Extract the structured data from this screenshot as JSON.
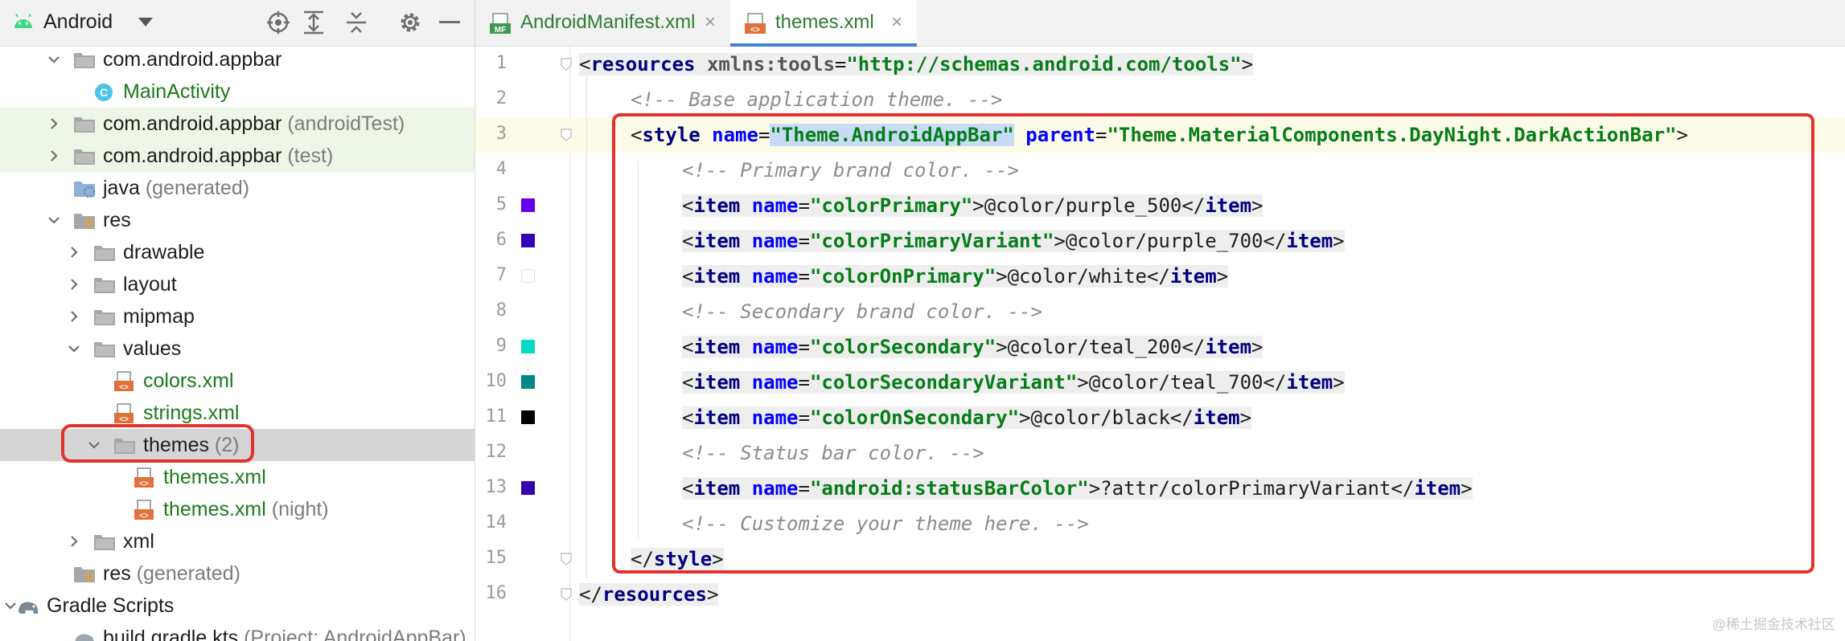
{
  "project_panel": {
    "view_label": "Android",
    "tree": [
      {
        "label": "com.android.appbar",
        "suffix": "",
        "type": "package",
        "arrow": "expanded"
      },
      {
        "label": "MainActivity",
        "suffix": "",
        "type": "class",
        "arrow": "none"
      },
      {
        "label": "com.android.appbar",
        "suffix": "(androidTest)",
        "type": "package",
        "arrow": "collapsed"
      },
      {
        "label": "com.android.appbar",
        "suffix": "(test)",
        "type": "package",
        "arrow": "collapsed"
      },
      {
        "label": "java",
        "suffix": "(generated)",
        "type": "folder-gen",
        "arrow": "none"
      },
      {
        "label": "res",
        "suffix": "",
        "type": "res",
        "arrow": "expanded"
      },
      {
        "label": "drawable",
        "suffix": "",
        "type": "folder",
        "arrow": "collapsed"
      },
      {
        "label": "layout",
        "suffix": "",
        "type": "folder",
        "arrow": "collapsed"
      },
      {
        "label": "mipmap",
        "suffix": "",
        "type": "folder",
        "arrow": "collapsed"
      },
      {
        "label": "values",
        "suffix": "",
        "type": "folder",
        "arrow": "expanded"
      },
      {
        "label": "colors.xml",
        "suffix": "",
        "type": "xml",
        "arrow": "none"
      },
      {
        "label": "strings.xml",
        "suffix": "",
        "type": "xml",
        "arrow": "none"
      },
      {
        "label": "themes",
        "suffix": "(2)",
        "type": "folder",
        "arrow": "expanded"
      },
      {
        "label": "themes.xml",
        "suffix": "",
        "type": "xml",
        "arrow": "none"
      },
      {
        "label": "themes.xml",
        "suffix": "(night)",
        "type": "xml",
        "arrow": "none"
      },
      {
        "label": "xml",
        "suffix": "",
        "type": "folder",
        "arrow": "collapsed"
      },
      {
        "label": "res",
        "suffix": "(generated)",
        "type": "res",
        "arrow": "none"
      },
      {
        "label": "Gradle Scripts",
        "suffix": "",
        "type": "gradle",
        "arrow": "expanded"
      },
      {
        "label": "build.gradle.kts",
        "suffix": "(Project: AndroidAppBar)",
        "type": "gradle-file",
        "arrow": "none"
      }
    ]
  },
  "tabs": [
    {
      "badge": "MF",
      "label": "AndroidManifest.xml",
      "close": "×",
      "active": false
    },
    {
      "badge": "<>",
      "label": "themes.xml",
      "close": "×",
      "active": true
    }
  ],
  "editor": {
    "line_numbers": [
      "1",
      "2",
      "3",
      "4",
      "5",
      "6",
      "7",
      "8",
      "9",
      "10",
      "11",
      "12",
      "13",
      "14",
      "15",
      "16"
    ],
    "swatches": {
      "5": "#6200ee",
      "6": "#3700b3",
      "7": "#ffffff",
      "9": "#03dac5",
      "10": "#018786",
      "11": "#000000",
      "13": "#3700b3"
    },
    "lines": [
      [
        [
          "t",
          "<"
        ],
        [
          "tag",
          "resources"
        ],
        [
          "t",
          " "
        ],
        [
          "ns",
          "xmlns:tools"
        ],
        [
          "t",
          "="
        ],
        [
          "val",
          "\"http://schemas.android.com/tools\""
        ],
        [
          "t",
          ">"
        ]
      ],
      [
        [
          "cmt",
          "<!-- Base application theme. -->"
        ]
      ],
      [
        [
          "t",
          "<"
        ],
        [
          "tag",
          "style"
        ],
        [
          "t",
          " "
        ],
        [
          "attr",
          "name"
        ],
        [
          "t",
          "="
        ],
        [
          "sel",
          "\"Theme.AndroidAppBar\""
        ],
        [
          "t",
          " "
        ],
        [
          "attr",
          "parent"
        ],
        [
          "t",
          "="
        ],
        [
          "val",
          "\"Theme.MaterialComponents.DayNight.DarkActionBar\""
        ],
        [
          "t",
          ">"
        ]
      ],
      [
        [
          "cmt",
          "<!-- Primary brand color. -->"
        ]
      ],
      [
        [
          "t",
          "<"
        ],
        [
          "tag",
          "item"
        ],
        [
          "t",
          " "
        ],
        [
          "attr",
          "name"
        ],
        [
          "t",
          "="
        ],
        [
          "val",
          "\"colorPrimary\""
        ],
        [
          "t",
          ">@color/purple_500</"
        ],
        [
          "tag",
          "item"
        ],
        [
          "t",
          ">"
        ]
      ],
      [
        [
          "t",
          "<"
        ],
        [
          "tag",
          "item"
        ],
        [
          "t",
          " "
        ],
        [
          "attr",
          "name"
        ],
        [
          "t",
          "="
        ],
        [
          "val",
          "\"colorPrimaryVariant\""
        ],
        [
          "t",
          ">@color/purple_700</"
        ],
        [
          "tag",
          "item"
        ],
        [
          "t",
          ">"
        ]
      ],
      [
        [
          "t",
          "<"
        ],
        [
          "tag",
          "item"
        ],
        [
          "t",
          " "
        ],
        [
          "attr",
          "name"
        ],
        [
          "t",
          "="
        ],
        [
          "val",
          "\"colorOnPrimary\""
        ],
        [
          "t",
          ">@color/white</"
        ],
        [
          "tag",
          "item"
        ],
        [
          "t",
          ">"
        ]
      ],
      [
        [
          "cmt",
          "<!-- Secondary brand color. -->"
        ]
      ],
      [
        [
          "t",
          "<"
        ],
        [
          "tag",
          "item"
        ],
        [
          "t",
          " "
        ],
        [
          "attr",
          "name"
        ],
        [
          "t",
          "="
        ],
        [
          "val",
          "\"colorSecondary\""
        ],
        [
          "t",
          ">@color/teal_200</"
        ],
        [
          "tag",
          "item"
        ],
        [
          "t",
          ">"
        ]
      ],
      [
        [
          "t",
          "<"
        ],
        [
          "tag",
          "item"
        ],
        [
          "t",
          " "
        ],
        [
          "attr",
          "name"
        ],
        [
          "t",
          "="
        ],
        [
          "val",
          "\"colorSecondaryVariant\""
        ],
        [
          "t",
          ">@color/teal_700</"
        ],
        [
          "tag",
          "item"
        ],
        [
          "t",
          ">"
        ]
      ],
      [
        [
          "t",
          "<"
        ],
        [
          "tag",
          "item"
        ],
        [
          "t",
          " "
        ],
        [
          "attr",
          "name"
        ],
        [
          "t",
          "="
        ],
        [
          "val",
          "\"colorOnSecondary\""
        ],
        [
          "t",
          ">@color/black</"
        ],
        [
          "tag",
          "item"
        ],
        [
          "t",
          ">"
        ]
      ],
      [
        [
          "cmt",
          "<!-- Status bar color. -->"
        ]
      ],
      [
        [
          "t",
          "<"
        ],
        [
          "tag",
          "item"
        ],
        [
          "t",
          " "
        ],
        [
          "attr",
          "name"
        ],
        [
          "t",
          "="
        ],
        [
          "val",
          "\"android:statusBarColor\""
        ],
        [
          "t",
          ">?attr/colorPrimaryVariant</"
        ],
        [
          "tag",
          "item"
        ],
        [
          "t",
          ">"
        ]
      ],
      [
        [
          "cmt",
          "<!-- Customize your theme here. -->"
        ]
      ],
      [
        [
          "t",
          "</"
        ],
        [
          "tag",
          "style"
        ],
        [
          "t",
          ">"
        ]
      ],
      [
        [
          "t",
          "</"
        ],
        [
          "tag",
          "resources"
        ],
        [
          "t",
          ">"
        ]
      ]
    ]
  },
  "watermark": "@稀土掘金技术社区",
  "colors": {
    "accent_tab": "#4083c9",
    "highlight": "#e4312b",
    "tag": "#000080",
    "value": "#067d17",
    "attr": "#0000ff"
  }
}
